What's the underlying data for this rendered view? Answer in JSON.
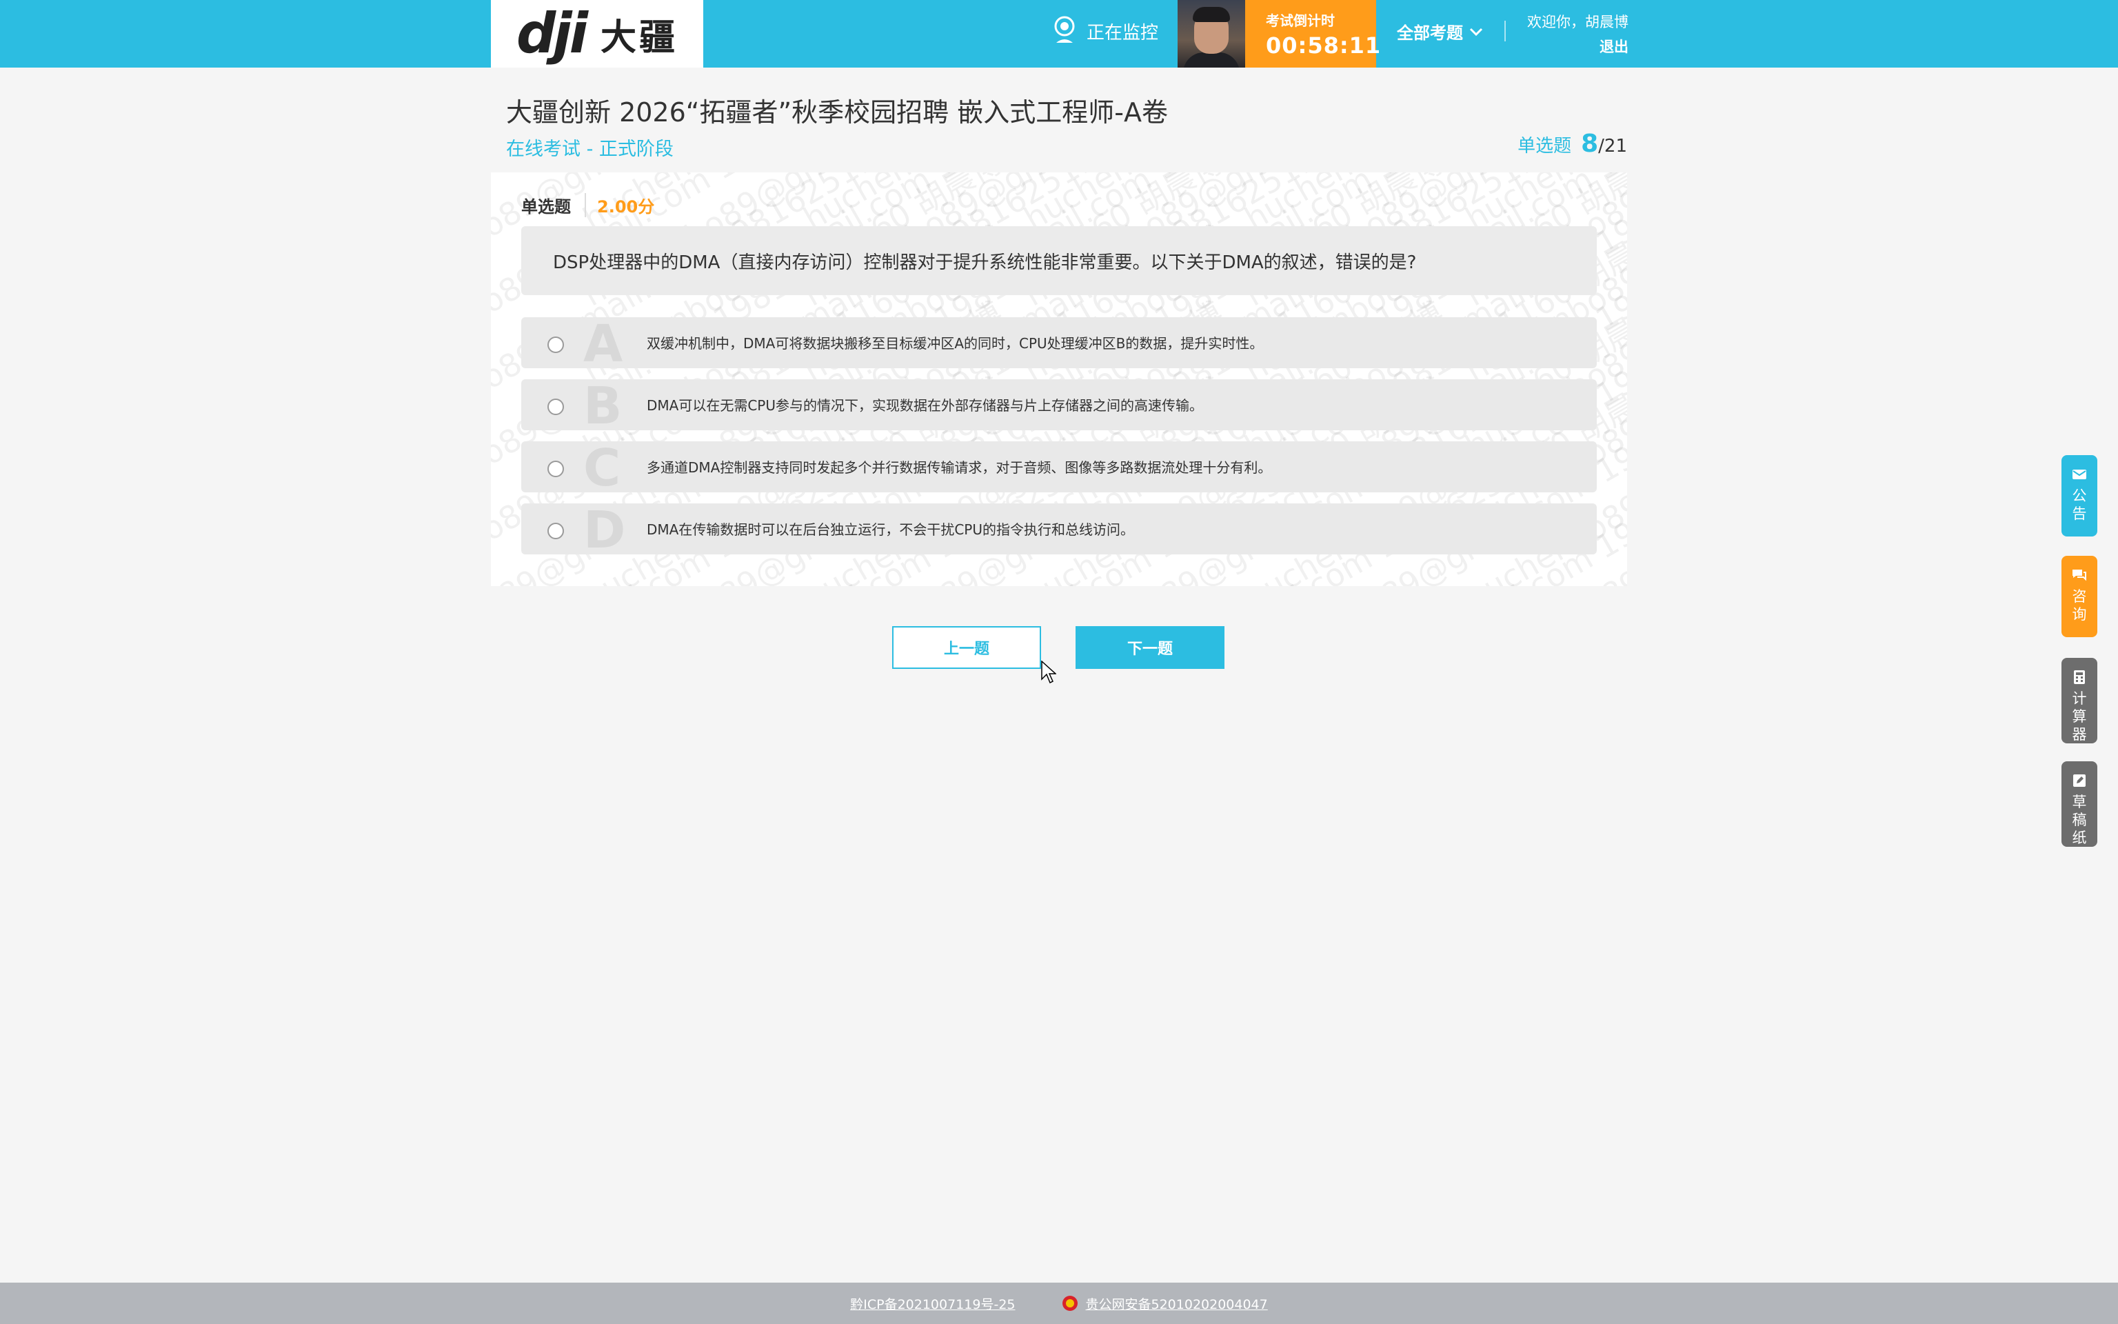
{
  "header": {
    "logo_mark": "dji",
    "logo_cn": "大疆",
    "monitor_label": "正在监控",
    "countdown_label": "考试倒计时",
    "countdown_time": "00:58:11",
    "all_questions_label": "全部考题",
    "welcome_text": "欢迎你，胡晨博",
    "logout_label": "退出",
    "colors": {
      "primary": "#2cbde1",
      "accent": "#ff9c1a"
    }
  },
  "exam": {
    "title": "大疆创新 2026“拓疆者”秋季校园招聘 嵌入式工程师-A卷",
    "stage": "在线考试 - 正式阶段",
    "progress_type": "单选题",
    "progress_current": "8",
    "progress_total": "/21"
  },
  "question": {
    "type": "单选题",
    "score": "2.00分",
    "stem": "DSP处理器中的DMA（直接内存访问）控制器对于提升系统性能非常重要。以下关于DMA的叙述，错误的是?",
    "options": [
      {
        "letter": "A",
        "text": "双缓冲机制中，DMA可将数据块搬移至目标缓冲区A的同时，CPU处理缓冲区B的数据，提升实时性。"
      },
      {
        "letter": "B",
        "text": "DMA可以在无需CPU参与的情况下，实现数据在外部存储器与片上存储器之间的高速传输。"
      },
      {
        "letter": "C",
        "text": "多通道DMA控制器支持同时发起多个并行数据传输请求，对于音频、图像等多路数据流处理十分有利。"
      },
      {
        "letter": "D",
        "text": "DMA在传输数据时可以在后台独立运行，不会干扰CPU的指令执行和总线访问。"
      }
    ],
    "watermark_text": "huchenbo89@gmail.com  19816251160  胡晨博"
  },
  "nav": {
    "prev_label": "上一题",
    "next_label": "下一题"
  },
  "side_tools": {
    "notice": "公告",
    "consult": "咨询",
    "calculator": "计算器",
    "draft": "草稿纸"
  },
  "footer": {
    "icp": "黔ICP备2021007119号-25",
    "police": "贵公网安备52010202004047"
  }
}
